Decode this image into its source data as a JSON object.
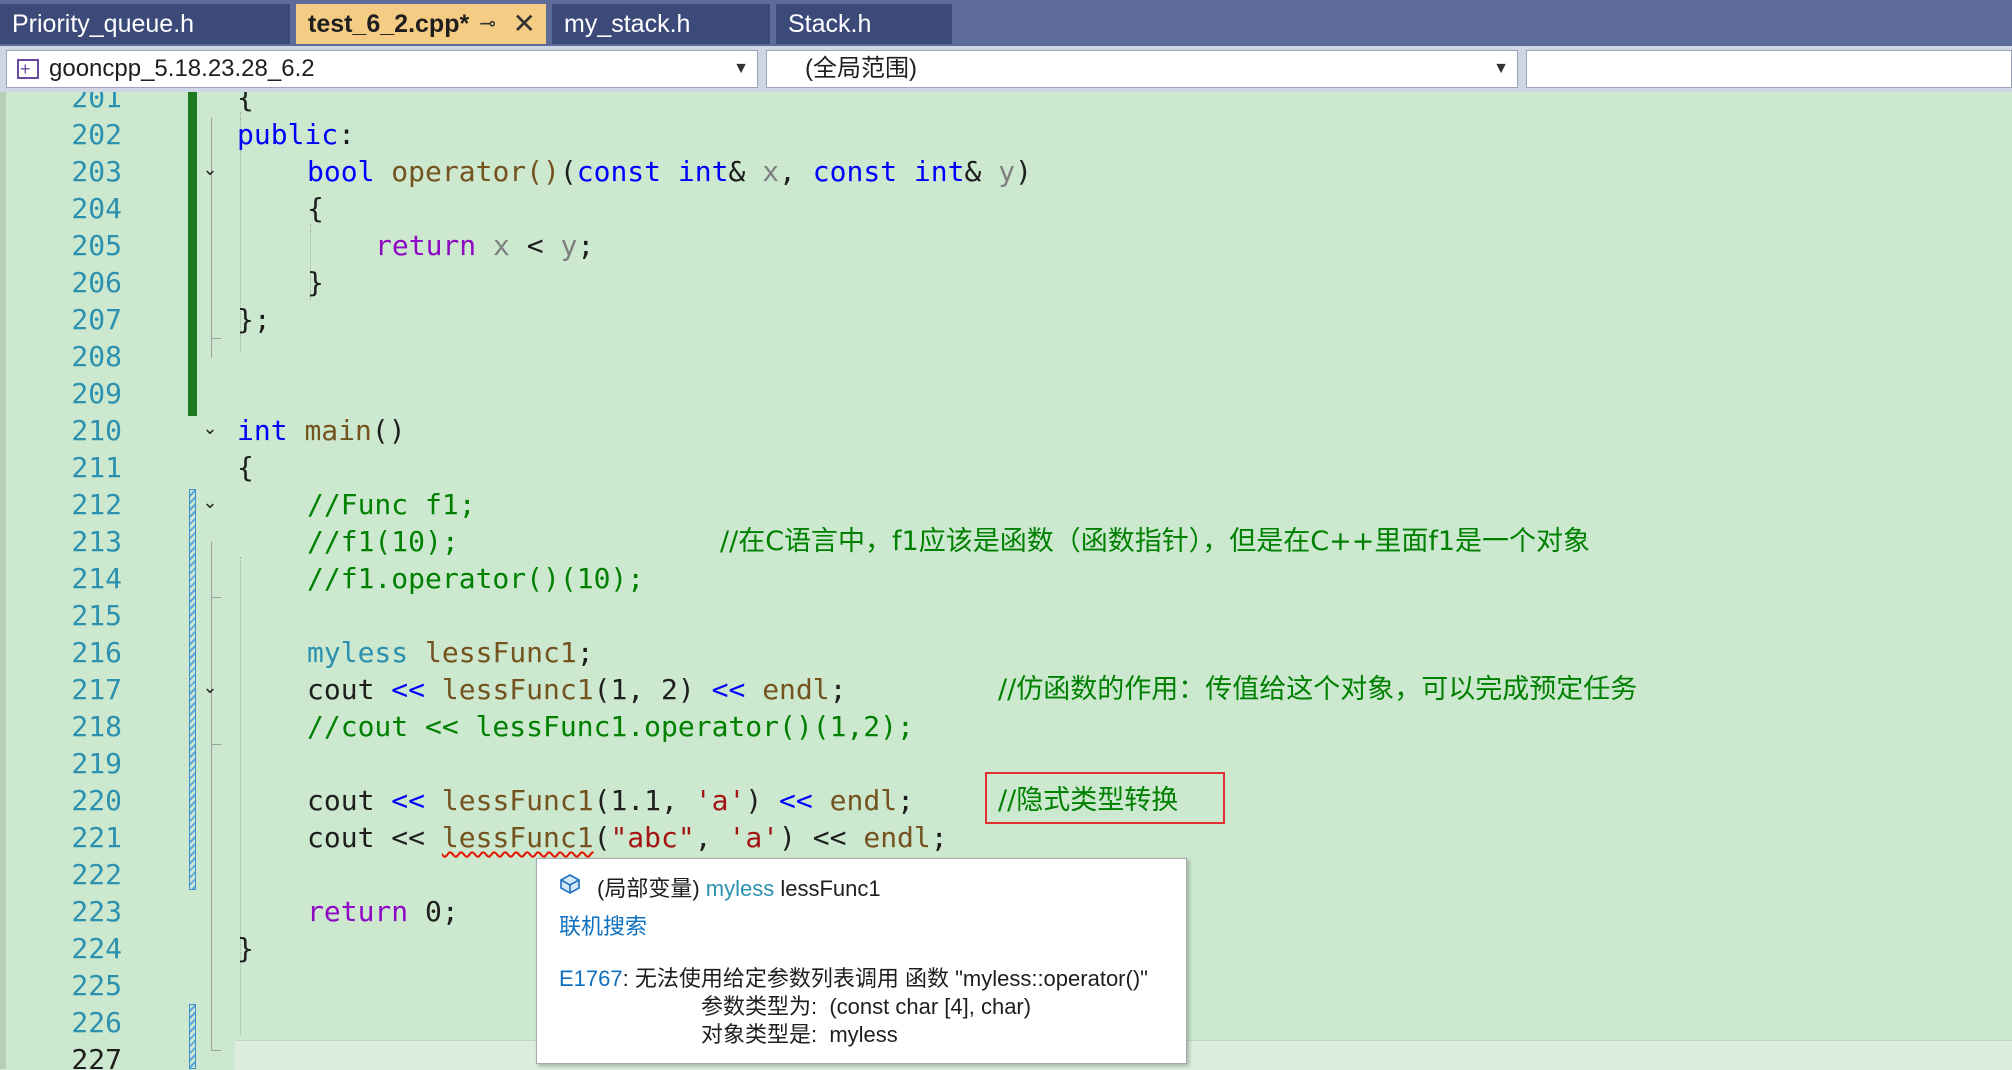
{
  "tabs": [
    {
      "label": "Priority_queue.h"
    },
    {
      "label": "test_6_2.cpp*",
      "active": true
    },
    {
      "label": "my_stack.h"
    },
    {
      "label": "Stack.h"
    }
  ],
  "tab_icons": {
    "pin": "⊸",
    "close": "✕"
  },
  "navbar": {
    "project": "gooncpp_5.18.23.28_6.2",
    "scope": "(全局范围)",
    "member": ""
  },
  "line_numbers": [
    "201",
    "202",
    "203",
    "204",
    "205",
    "206",
    "207",
    "208",
    "209",
    "210",
    "211",
    "212",
    "213",
    "214",
    "215",
    "216",
    "217",
    "218",
    "219",
    "220",
    "221",
    "222",
    "223",
    "224",
    "225",
    "226",
    "227"
  ],
  "code": {
    "l201": "{",
    "l202_kw": "public",
    "l202_rest": ":",
    "l203": {
      "bool": "bool",
      "op": "operator()",
      "p1": "(",
      "const1": "const",
      "int1": "int",
      "amp1": "& ",
      "x": "x",
      "comma": ", ",
      "const2": "const",
      "int2": "int",
      "amp2": "& ",
      "y": "y",
      "close": ")"
    },
    "l204": "{",
    "l205": {
      "ret": "return",
      "x": "x",
      "lt": " < ",
      "y": "y",
      "semi": ";"
    },
    "l206": "}",
    "l207": "};",
    "l210": {
      "int": "int",
      "main": "main",
      "paren": "()"
    },
    "l211": "{",
    "l212": "//Func f1;",
    "l213_code": "//f1(10);",
    "l213_cmt": "//在C语言中，f1应该是函数（函数指针），但是在C++里面f1是一个对象",
    "l214": "//f1.operator()(10);",
    "l216": {
      "type": "myless",
      "var": "lessFunc1",
      "semi": ";"
    },
    "l217": {
      "cout": "cout",
      "op1": " << ",
      "fn": "lessFunc1",
      "args": "(1, 2)",
      "op2": " << ",
      "endl": "endl",
      "semi": ";",
      "cmt": "//仿函数的作用：传值给这个对象，可以完成预定任务"
    },
    "l218": "//cout << lessFunc1.operator()(1,2);",
    "l220": {
      "cout": "cout",
      "op1": " << ",
      "fn": "lessFunc1",
      "p1": "(1.1, ",
      "ch": "'a'",
      "p2": ")",
      "op2": " << ",
      "endl": "endl",
      "semi": ";",
      "cmt": "//隐式类型转换"
    },
    "l221": {
      "cout": "cout",
      "op1": " << ",
      "fn": "lessFunc1",
      "p1": "(",
      "str": "\"abc\"",
      "comma": ", ",
      "ch": "'a'",
      "p2": ")",
      "op2": " << ",
      "endl": "endl",
      "semi": ";"
    },
    "l223": {
      "ret": "return",
      "val": " 0;"
    },
    "l224": "}"
  },
  "tooltip": {
    "icon": "local-variable-icon",
    "scope": "(局部变量)",
    "type": "myless",
    "name": "lessFunc1",
    "search_link": "联机搜索",
    "error_code": "E1767",
    "error_msg": ": 无法使用给定参数列表调用 函数 \"myless::operator()\"",
    "arg_types": "参数类型为:  (const char [4], char)",
    "obj_type": "对象类型是:  myless"
  },
  "colors": {
    "editor_bg": "#cce8cf",
    "keyword": "#0000ff",
    "comment": "#008000",
    "line_number": "#2b91af",
    "highlight_box": "#e03030"
  }
}
